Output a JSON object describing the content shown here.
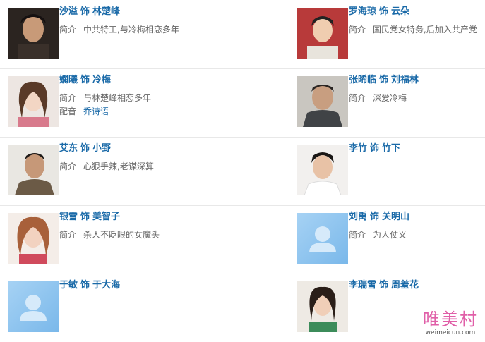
{
  "labels": {
    "shi": "饰",
    "intro": "简介",
    "dub": "配音"
  },
  "cast": [
    {
      "actor": "沙溢",
      "role": "林楚峰",
      "intro": "中共特工,与冷梅相恋多年",
      "photo": "actor-photo"
    },
    {
      "actor": "罗海琼",
      "role": "云朵",
      "intro": "国民党女特务,后加入共产党",
      "photo": "actor-photo"
    },
    {
      "actor": "嫻曦",
      "role": "冷梅",
      "intro": "与林楚峰相恋多年",
      "dub": "乔诗语",
      "photo": "actor-photo"
    },
    {
      "actor": "张晞临",
      "role": "刘福林",
      "intro": "深爱冷梅",
      "photo": "actor-photo"
    },
    {
      "actor": "艾东",
      "role": "小野",
      "intro": "心狠手辣,老谋深算",
      "photo": "actor-photo"
    },
    {
      "actor": "李竹",
      "role": "竹下",
      "photo": "actor-photo"
    },
    {
      "actor": "银雪",
      "role": "美智子",
      "intro": "杀人不眨眼的女魔头",
      "photo": "actor-photo"
    },
    {
      "actor": "刘禹",
      "role": "关明山",
      "intro": "为人仗义",
      "photo": "default-avatar-icon"
    },
    {
      "actor": "于敏",
      "role": "于大海",
      "photo": "default-avatar-icon"
    },
    {
      "actor": "李瑞雪",
      "role": "周羞花",
      "photo": "actor-photo"
    }
  ],
  "watermark": {
    "title": "唯美村",
    "url": "weimeicun.com"
  }
}
